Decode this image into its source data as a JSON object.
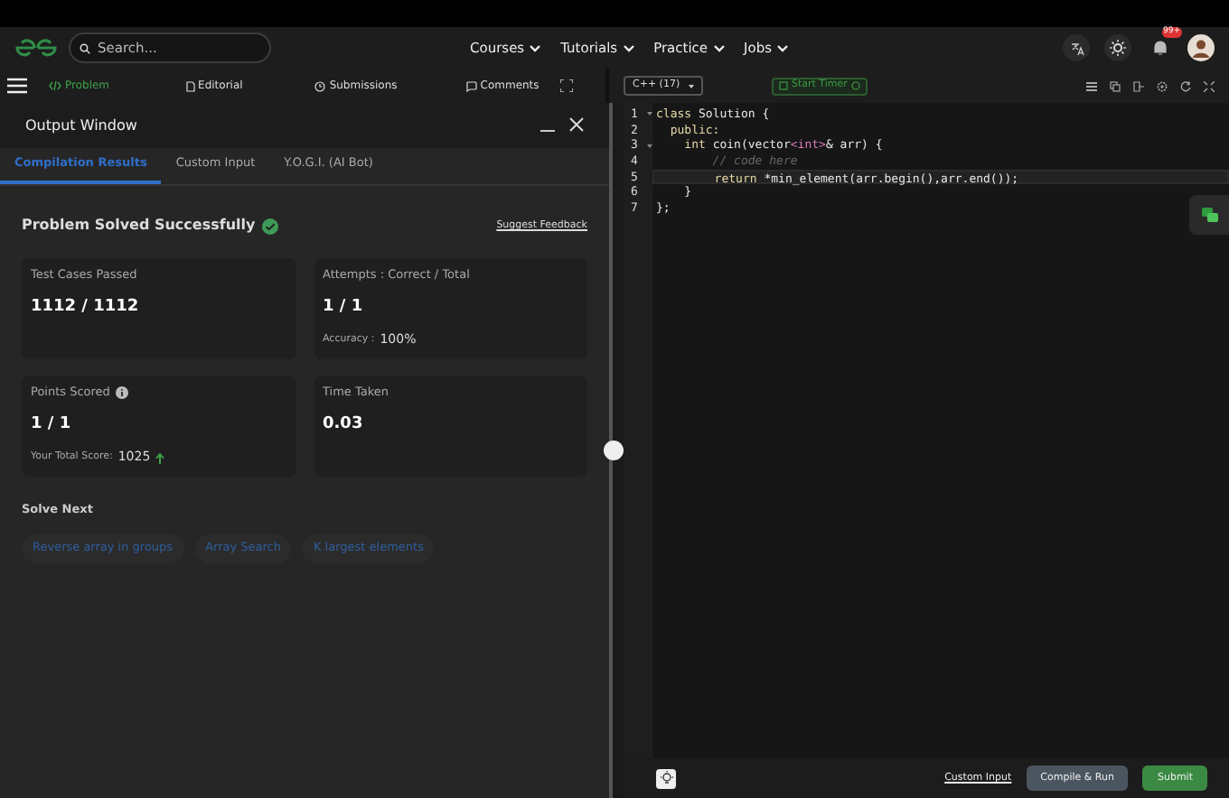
{
  "nav": {
    "search": {
      "placeholder": "Search..."
    },
    "menu": [
      {
        "label": "Courses"
      },
      {
        "label": "Tutorials"
      },
      {
        "label": "Practice"
      },
      {
        "label": "Jobs"
      }
    ],
    "notification_badge": "99+"
  },
  "problem_tabs": [
    {
      "label": "Problem",
      "selected": true
    },
    {
      "label": "Editorial",
      "selected": false
    },
    {
      "label": "Submissions",
      "selected": false
    },
    {
      "label": "Comments",
      "selected": false
    }
  ],
  "editor_toolbar": {
    "language": "C++ (17)",
    "timer_button": "Start Timer"
  },
  "output_window": {
    "title": "Output Window",
    "tabs": [
      {
        "label": "Compilation Results",
        "selected": true
      },
      {
        "label": "Custom Input",
        "selected": false
      },
      {
        "label": "Y.O.G.I. (AI Bot)",
        "selected": false
      }
    ],
    "status": "Problem Solved Successfully",
    "feedback_link": "Suggest Feedback",
    "stats": [
      {
        "label": "Test Cases Passed",
        "value": "1112 / 1112"
      },
      {
        "label": "Attempts : Correct / Total",
        "value": "1 / 1",
        "note_label": "Accuracy :",
        "note_value": "100%"
      },
      {
        "label": "Points Scored",
        "value": "1 / 1",
        "info": true,
        "note_label": "Your Total Score:",
        "note_value": "1025",
        "trend_up": true
      },
      {
        "label": "Time Taken",
        "value": "0.03"
      }
    ],
    "solve_next_title": "Solve Next",
    "solve_next": [
      "Reverse array in groups",
      "Array Search",
      "K largest elements"
    ]
  },
  "code": {
    "lines": [
      {
        "number": "1",
        "fold": true,
        "current": false,
        "tokens": [
          {
            "kind": "keyword",
            "text": "class"
          },
          {
            "kind": "plain",
            "text": " Solution {"
          }
        ]
      },
      {
        "number": "2",
        "fold": false,
        "current": false,
        "tokens": [
          {
            "kind": "keyword",
            "text": "  public:"
          }
        ]
      },
      {
        "number": "3",
        "fold": true,
        "current": false,
        "tokens": [
          {
            "kind": "keyword",
            "text": "    int"
          },
          {
            "kind": "plain",
            "text": " coin(vector"
          },
          {
            "kind": "template",
            "text": "<int>"
          },
          {
            "kind": "plain",
            "text": "& arr) {"
          }
        ]
      },
      {
        "number": "4",
        "fold": false,
        "current": false,
        "tokens": [
          {
            "kind": "comment",
            "text": "        // code here"
          }
        ]
      },
      {
        "number": "5",
        "fold": false,
        "current": true,
        "tokens": [
          {
            "kind": "keyword",
            "text": "        return"
          },
          {
            "kind": "plain",
            "text": " *min_element(arr.begin(),arr.end());"
          }
        ]
      },
      {
        "number": "6",
        "fold": false,
        "current": false,
        "tokens": [
          {
            "kind": "plain",
            "text": "    }"
          }
        ]
      },
      {
        "number": "7",
        "fold": false,
        "current": false,
        "tokens": [
          {
            "kind": "plain",
            "text": "};"
          }
        ]
      }
    ]
  },
  "footer": {
    "custom_input": "Custom Input",
    "compile_button": "Compile & Run",
    "submit_button": "Submit"
  }
}
